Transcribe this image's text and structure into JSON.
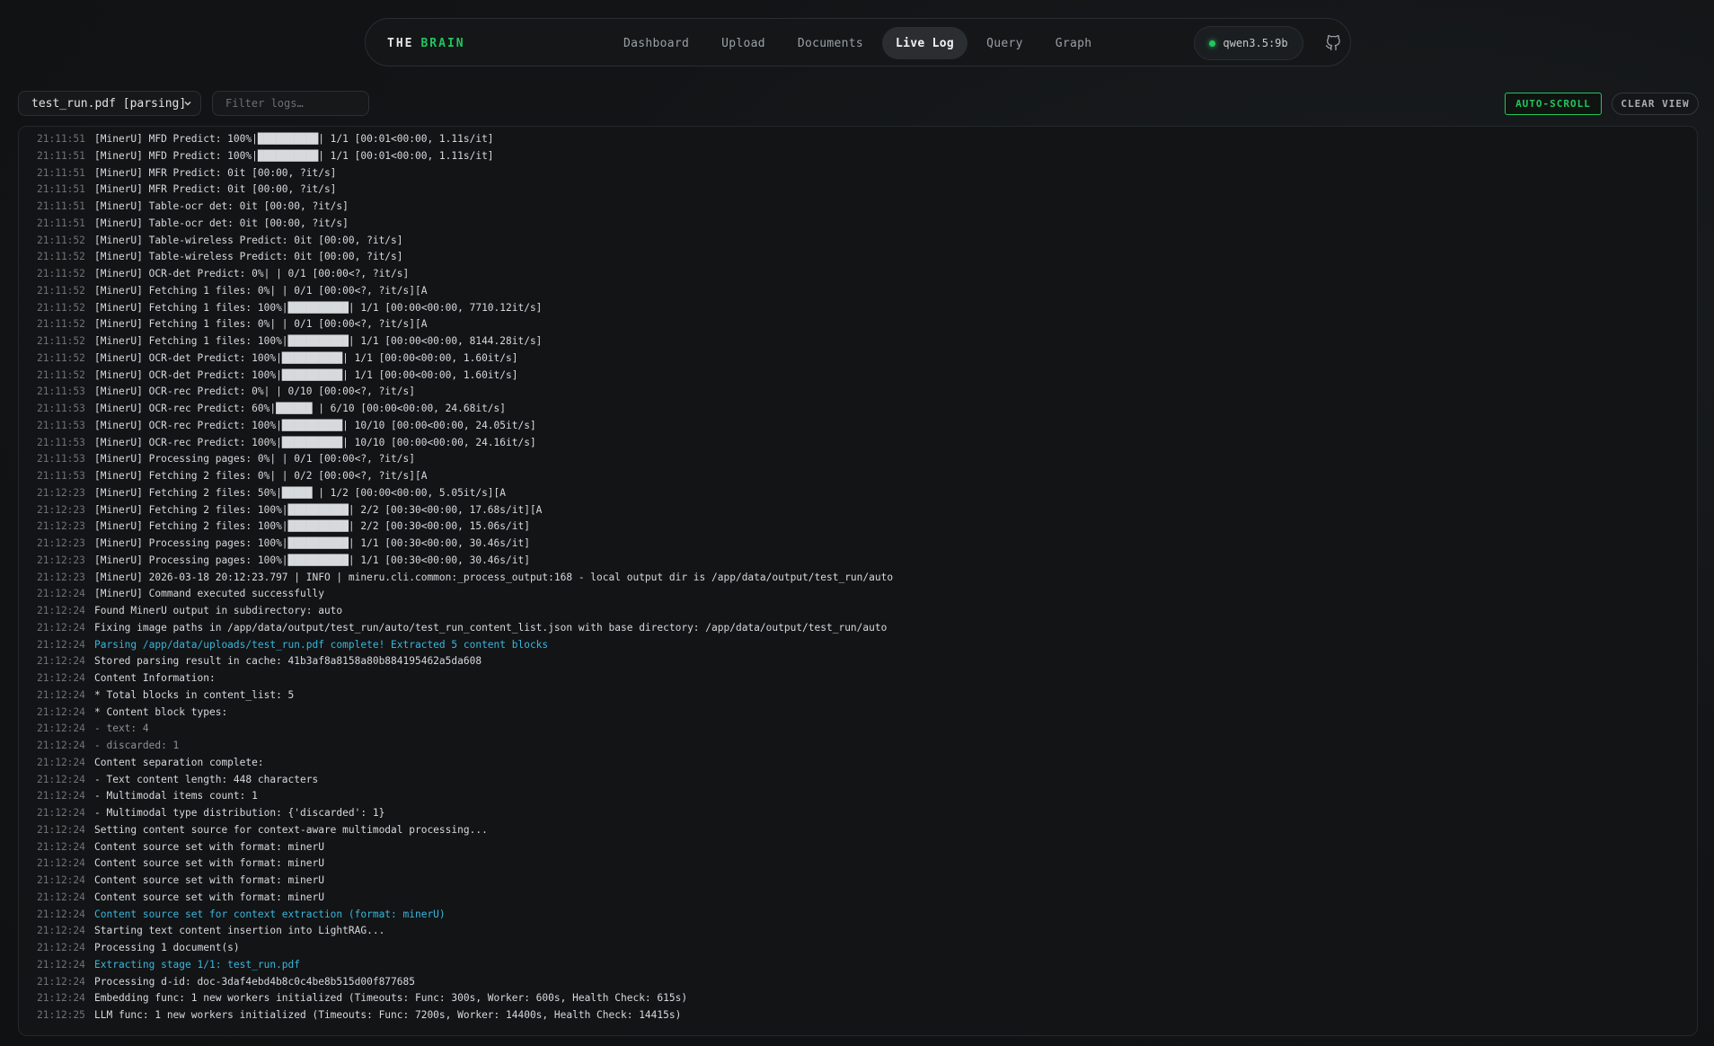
{
  "nav": {
    "brand_prefix": "THE",
    "brand_accent": "BRAIN",
    "tabs": [
      {
        "label": "Dashboard",
        "active": false
      },
      {
        "label": "Upload",
        "active": false
      },
      {
        "label": "Documents",
        "active": false
      },
      {
        "label": "Live Log",
        "active": true
      },
      {
        "label": "Query",
        "active": false
      },
      {
        "label": "Graph",
        "active": false
      }
    ],
    "model": "qwen3.5:9b",
    "status_color": "#22c55e",
    "github_icon": "github-icon"
  },
  "toolbar": {
    "source_select": "test_run.pdf [parsing]",
    "filter_placeholder": "Filter logs…",
    "auto_scroll_label": "AUTO-SCROLL",
    "clear_view_label": "CLEAR VIEW"
  },
  "colors": {
    "accent": "#22c55e",
    "info": "#3ab6dc"
  },
  "logs": [
    {
      "time": "21:11:51",
      "text": "[MinerU] MFD Predict: 100%|██████████| 1/1 [00:01<00:00, 1.11s/it]",
      "level": "normal"
    },
    {
      "time": "21:11:51",
      "text": "[MinerU] MFD Predict: 100%|██████████| 1/1 [00:01<00:00, 1.11s/it]",
      "level": "normal"
    },
    {
      "time": "21:11:51",
      "text": "[MinerU] MFR Predict: 0it [00:00, ?it/s]",
      "level": "normal"
    },
    {
      "time": "21:11:51",
      "text": "[MinerU] MFR Predict: 0it [00:00, ?it/s]",
      "level": "normal"
    },
    {
      "time": "21:11:51",
      "text": "[MinerU] Table-ocr det: 0it [00:00, ?it/s]",
      "level": "normal"
    },
    {
      "time": "21:11:51",
      "text": "[MinerU] Table-ocr det: 0it [00:00, ?it/s]",
      "level": "normal"
    },
    {
      "time": "21:11:52",
      "text": "[MinerU] Table-wireless Predict: 0it [00:00, ?it/s]",
      "level": "normal"
    },
    {
      "time": "21:11:52",
      "text": "[MinerU] Table-wireless Predict: 0it [00:00, ?it/s]",
      "level": "normal"
    },
    {
      "time": "21:11:52",
      "text": "[MinerU] OCR-det Predict: 0%| | 0/1 [00:00<?, ?it/s]",
      "level": "normal"
    },
    {
      "time": "21:11:52",
      "text": "[MinerU] Fetching 1 files: 0%| | 0/1 [00:00<?, ?it/s][A",
      "level": "normal"
    },
    {
      "time": "21:11:52",
      "text": "[MinerU] Fetching 1 files: 100%|██████████| 1/1 [00:00<00:00, 7710.12it/s]",
      "level": "normal"
    },
    {
      "time": "21:11:52",
      "text": "[MinerU] Fetching 1 files: 0%| | 0/1 [00:00<?, ?it/s][A",
      "level": "normal"
    },
    {
      "time": "21:11:52",
      "text": "[MinerU] Fetching 1 files: 100%|██████████| 1/1 [00:00<00:00, 8144.28it/s]",
      "level": "normal"
    },
    {
      "time": "21:11:52",
      "text": "[MinerU] OCR-det Predict: 100%|██████████| 1/1 [00:00<00:00, 1.60it/s]",
      "level": "normal"
    },
    {
      "time": "21:11:52",
      "text": "[MinerU] OCR-det Predict: 100%|██████████| 1/1 [00:00<00:00, 1.60it/s]",
      "level": "normal"
    },
    {
      "time": "21:11:53",
      "text": "[MinerU] OCR-rec Predict: 0%| | 0/10 [00:00<?, ?it/s]",
      "level": "normal"
    },
    {
      "time": "21:11:53",
      "text": "[MinerU] OCR-rec Predict: 60%|██████ | 6/10 [00:00<00:00, 24.68it/s]",
      "level": "normal"
    },
    {
      "time": "21:11:53",
      "text": "[MinerU] OCR-rec Predict: 100%|██████████| 10/10 [00:00<00:00, 24.05it/s]",
      "level": "normal"
    },
    {
      "time": "21:11:53",
      "text": "[MinerU] OCR-rec Predict: 100%|██████████| 10/10 [00:00<00:00, 24.16it/s]",
      "level": "normal"
    },
    {
      "time": "21:11:53",
      "text": "[MinerU] Processing pages: 0%| | 0/1 [00:00<?, ?it/s]",
      "level": "normal"
    },
    {
      "time": "21:11:53",
      "text": "[MinerU] Fetching 2 files: 0%| | 0/2 [00:00<?, ?it/s][A",
      "level": "normal"
    },
    {
      "time": "21:12:23",
      "text": "[MinerU] Fetching 2 files: 50%|█████ | 1/2 [00:00<00:00, 5.05it/s][A",
      "level": "normal"
    },
    {
      "time": "21:12:23",
      "text": "[MinerU] Fetching 2 files: 100%|██████████| 2/2 [00:30<00:00, 17.68s/it][A",
      "level": "normal"
    },
    {
      "time": "21:12:23",
      "text": "[MinerU] Fetching 2 files: 100%|██████████| 2/2 [00:30<00:00, 15.06s/it]",
      "level": "normal"
    },
    {
      "time": "21:12:23",
      "text": "[MinerU] Processing pages: 100%|██████████| 1/1 [00:30<00:00, 30.46s/it]",
      "level": "normal"
    },
    {
      "time": "21:12:23",
      "text": "[MinerU] Processing pages: 100%|██████████| 1/1 [00:30<00:00, 30.46s/it]",
      "level": "normal"
    },
    {
      "time": "21:12:23",
      "text": "[MinerU] 2026-03-18 20:12:23.797 | INFO | mineru.cli.common:_process_output:168 - local output dir is /app/data/output/test_run/auto",
      "level": "normal"
    },
    {
      "time": "21:12:24",
      "text": "[MinerU] Command executed successfully",
      "level": "normal"
    },
    {
      "time": "21:12:24",
      "text": "Found MinerU output in subdirectory: auto",
      "level": "normal"
    },
    {
      "time": "21:12:24",
      "text": "Fixing image paths in /app/data/output/test_run/auto/test_run_content_list.json with base directory: /app/data/output/test_run/auto",
      "level": "normal"
    },
    {
      "time": "21:12:24",
      "text": "Parsing /app/data/uploads/test_run.pdf complete! Extracted 5 content blocks",
      "level": "info"
    },
    {
      "time": "21:12:24",
      "text": "Stored parsing result in cache: 41b3af8a8158a80b884195462a5da608",
      "level": "normal"
    },
    {
      "time": "21:12:24",
      "text": "Content Information:",
      "level": "normal"
    },
    {
      "time": "21:12:24",
      "text": "* Total blocks in content_list: 5",
      "level": "normal"
    },
    {
      "time": "21:12:24",
      "text": "* Content block types:",
      "level": "normal"
    },
    {
      "time": "21:12:24",
      "text": "- text: 4",
      "level": "muted"
    },
    {
      "time": "21:12:24",
      "text": "- discarded: 1",
      "level": "muted"
    },
    {
      "time": "21:12:24",
      "text": "Content separation complete:",
      "level": "normal"
    },
    {
      "time": "21:12:24",
      "text": "- Text content length: 448 characters",
      "level": "normal"
    },
    {
      "time": "21:12:24",
      "text": "- Multimodal items count: 1",
      "level": "normal"
    },
    {
      "time": "21:12:24",
      "text": "- Multimodal type distribution: {'discarded': 1}",
      "level": "normal"
    },
    {
      "time": "21:12:24",
      "text": "Setting content source for context-aware multimodal processing...",
      "level": "normal"
    },
    {
      "time": "21:12:24",
      "text": "Content source set with format: minerU",
      "level": "normal"
    },
    {
      "time": "21:12:24",
      "text": "Content source set with format: minerU",
      "level": "normal"
    },
    {
      "time": "21:12:24",
      "text": "Content source set with format: minerU",
      "level": "normal"
    },
    {
      "time": "21:12:24",
      "text": "Content source set with format: minerU",
      "level": "normal"
    },
    {
      "time": "21:12:24",
      "text": "Content source set for context extraction (format: minerU)",
      "level": "info"
    },
    {
      "time": "21:12:24",
      "text": "Starting text content insertion into LightRAG...",
      "level": "normal"
    },
    {
      "time": "21:12:24",
      "text": "Processing 1 document(s)",
      "level": "normal"
    },
    {
      "time": "21:12:24",
      "text": "Extracting stage 1/1: test_run.pdf",
      "level": "info"
    },
    {
      "time": "21:12:24",
      "text": "Processing d-id: doc-3daf4ebd4b8c0c4be8b515d00f877685",
      "level": "normal"
    },
    {
      "time": "21:12:24",
      "text": "Embedding func: 1 new workers initialized (Timeouts: Func: 300s, Worker: 600s, Health Check: 615s)",
      "level": "normal"
    },
    {
      "time": "21:12:25",
      "text": "LLM func: 1 new workers initialized (Timeouts: Func: 7200s, Worker: 14400s, Health Check: 14415s)",
      "level": "normal"
    }
  ]
}
